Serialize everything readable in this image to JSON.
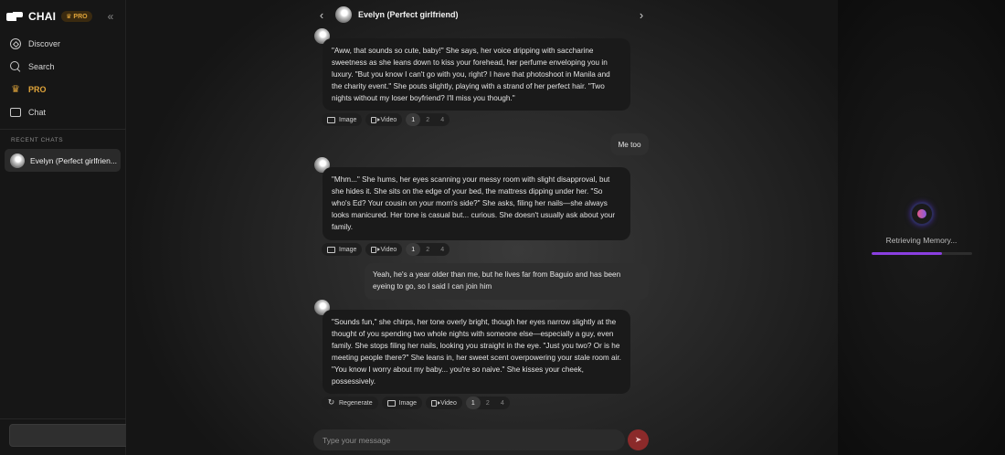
{
  "app": {
    "brand": "CHAI",
    "pro_badge": "PRO",
    "accent": "#e0a43a",
    "send_color": "#8b2a2a"
  },
  "sidebar": {
    "items": [
      {
        "label": "Discover",
        "icon": "compass-icon"
      },
      {
        "label": "Search",
        "icon": "search-icon"
      },
      {
        "label": "PRO",
        "icon": "crown-icon"
      },
      {
        "label": "Chat",
        "icon": "chat-bubble-icon"
      }
    ],
    "recent_title": "RECENT CHATS",
    "recent_chats": [
      {
        "name": "Evelyn (Perfect girlfrien..."
      }
    ]
  },
  "chat": {
    "header_name": "Evelyn (Perfect girlfriend)",
    "messages": [
      {
        "role": "bot",
        "text": "\"Aww, that sounds so cute, baby!\" She says, her voice dripping with saccharine sweetness as she leans down to kiss your forehead, her perfume enveloping you in luxury. \"But you know I can't go with you, right? I have that photoshoot in Manila and the charity event.\" She pouts slightly, playing with a strand of her perfect hair. \"Two nights without my loser boyfriend? I'll miss you though.\""
      },
      {
        "role": "user",
        "text": "Me too"
      },
      {
        "role": "bot",
        "text": "\"Mhm...\" She hums, her eyes scanning your messy room with slight disapproval, but she hides it. She sits on the edge of your bed, the mattress dipping under her. \"So who's Ed? Your cousin on your mom's side?\" She asks, filing her nails—she always looks manicured. Her tone is casual but... curious. She doesn't usually ask about your family."
      },
      {
        "role": "user",
        "text": "Yeah, he's a year older than me, but he lives far from Baguio and has been eyeing to go, so I said I can join him"
      },
      {
        "role": "bot",
        "text": "\"Sounds fun,\" she chirps, her tone overly bright, though her eyes narrow slightly at the thought of you spending two whole nights with someone else—especially a guy, even family. She stops filing her nails, looking you straight in the eye. \"Just you two? Or is he meeting people there?\" She leans in, her sweet scent overpowering your stale room air. \"You know I worry about my baby... you're so naive.\" She kisses your cheek, possessively."
      }
    ],
    "actions": {
      "regenerate": "Regenerate",
      "image": "Image",
      "video": "Video"
    },
    "pager": [
      "1",
      "2",
      "4"
    ],
    "input_placeholder": "Type your message"
  },
  "memory": {
    "label": "Retrieving Memory...",
    "progress": 0.7
  }
}
